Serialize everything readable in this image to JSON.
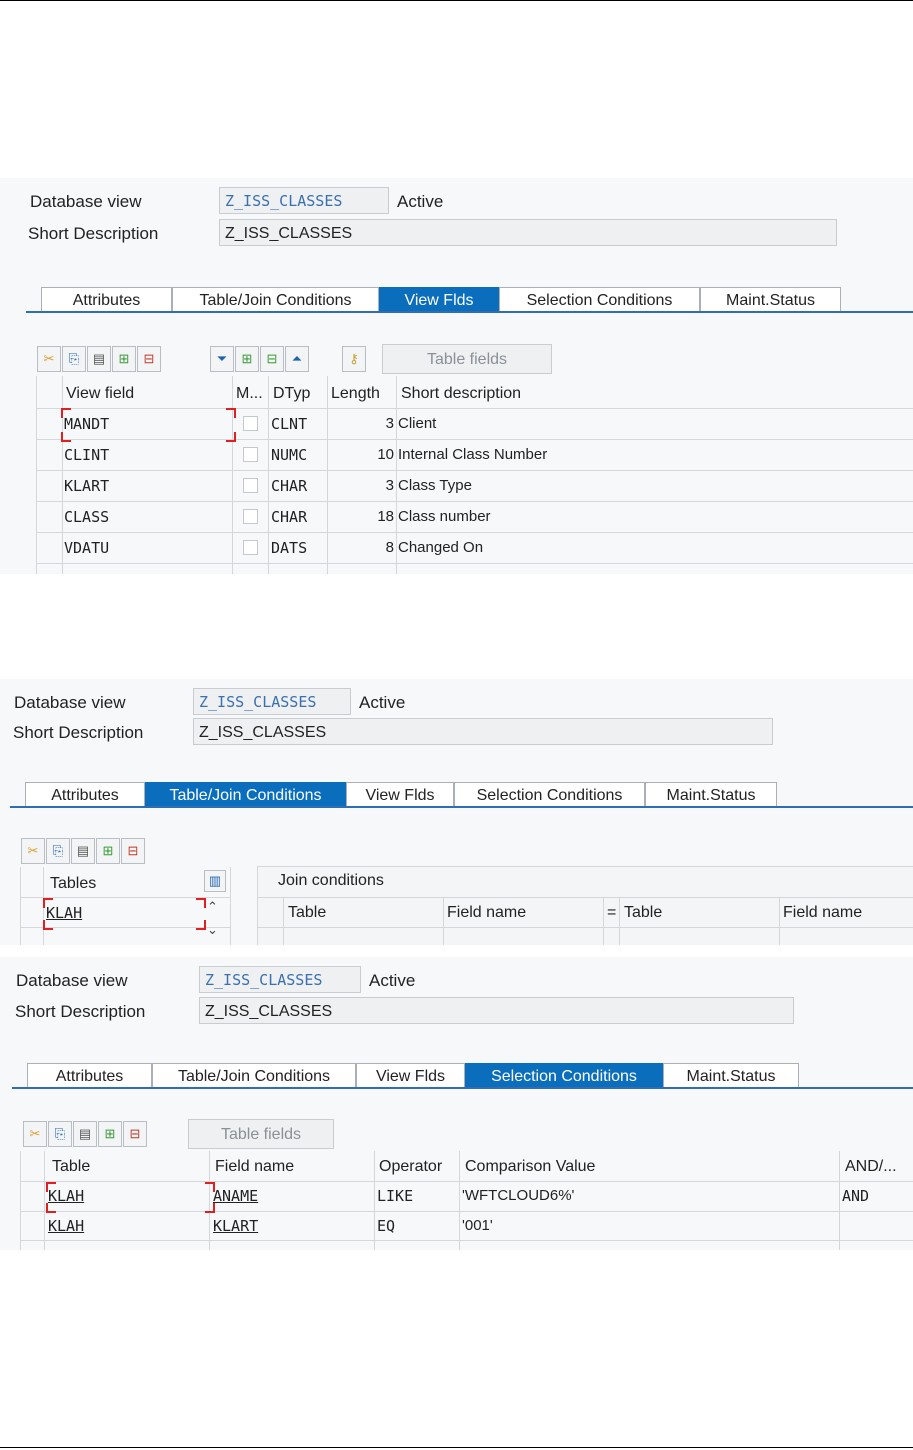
{
  "s1": {
    "db_label": "Database view",
    "db_value": "Z_ISS_CLASSES",
    "status": "Active",
    "sd_label": "Short Description",
    "sd_value": "Z_ISS_CLASSES",
    "tabs": [
      "Attributes",
      "Table/Join Conditions",
      "View Flds",
      "Selection Conditions",
      "Maint.Status"
    ],
    "active_tab": "View Flds",
    "table_fields_btn": "Table fields",
    "columns": [
      "View field",
      "M...",
      "DTyp",
      "Length",
      "Short description"
    ],
    "rows": [
      {
        "field": "MANDT",
        "dtyp": "CLNT",
        "length": "3",
        "desc": "Client"
      },
      {
        "field": "CLINT",
        "dtyp": "NUMC",
        "length": "10",
        "desc": "Internal Class Number"
      },
      {
        "field": "KLART",
        "dtyp": "CHAR",
        "length": "3",
        "desc": "Class Type"
      },
      {
        "field": "CLASS",
        "dtyp": "CHAR",
        "length": "18",
        "desc": "Class number"
      },
      {
        "field": "VDATU",
        "dtyp": "DATS",
        "length": "8",
        "desc": "Changed On"
      }
    ]
  },
  "s2": {
    "db_label": "Database view",
    "db_value": "Z_ISS_CLASSES",
    "status": "Active",
    "sd_label": "Short Description",
    "sd_value": "Z_ISS_CLASSES",
    "tabs": [
      "Attributes",
      "Table/Join Conditions",
      "View Flds",
      "Selection Conditions",
      "Maint.Status"
    ],
    "active_tab": "Table/Join Conditions",
    "tables_header": "Tables",
    "tables_rows": [
      "KLAH"
    ],
    "join_header": "Join conditions",
    "join_columns": [
      "Table",
      "Field name",
      "=",
      "Table",
      "Field name"
    ]
  },
  "s3": {
    "db_label": "Database view",
    "db_value": "Z_ISS_CLASSES",
    "status": "Active",
    "sd_label": "Short Description",
    "sd_value": "Z_ISS_CLASSES",
    "tabs": [
      "Attributes",
      "Table/Join Conditions",
      "View Flds",
      "Selection Conditions",
      "Maint.Status"
    ],
    "active_tab": "Selection Conditions",
    "table_fields_btn": "Table fields",
    "columns": [
      "Table",
      "Field name",
      "Operator",
      "Comparison Value",
      "AND/..."
    ],
    "rows": [
      {
        "table": "KLAH",
        "field": "ANAME",
        "op": "LIKE",
        "value": "'WFTCLOUD6%'",
        "andor": "AND"
      },
      {
        "table": "KLAH",
        "field": "KLART",
        "op": "EQ",
        "value": "'001'",
        "andor": ""
      }
    ]
  },
  "icons": [
    "cut-icon",
    "copy-icon",
    "paste-icon",
    "insert-row-icon",
    "delete-row-icon"
  ],
  "colors": {
    "tab_active": "#0a6ebd",
    "tab_line": "#2f6eb5",
    "key_field_text": "#3a6fb0"
  }
}
